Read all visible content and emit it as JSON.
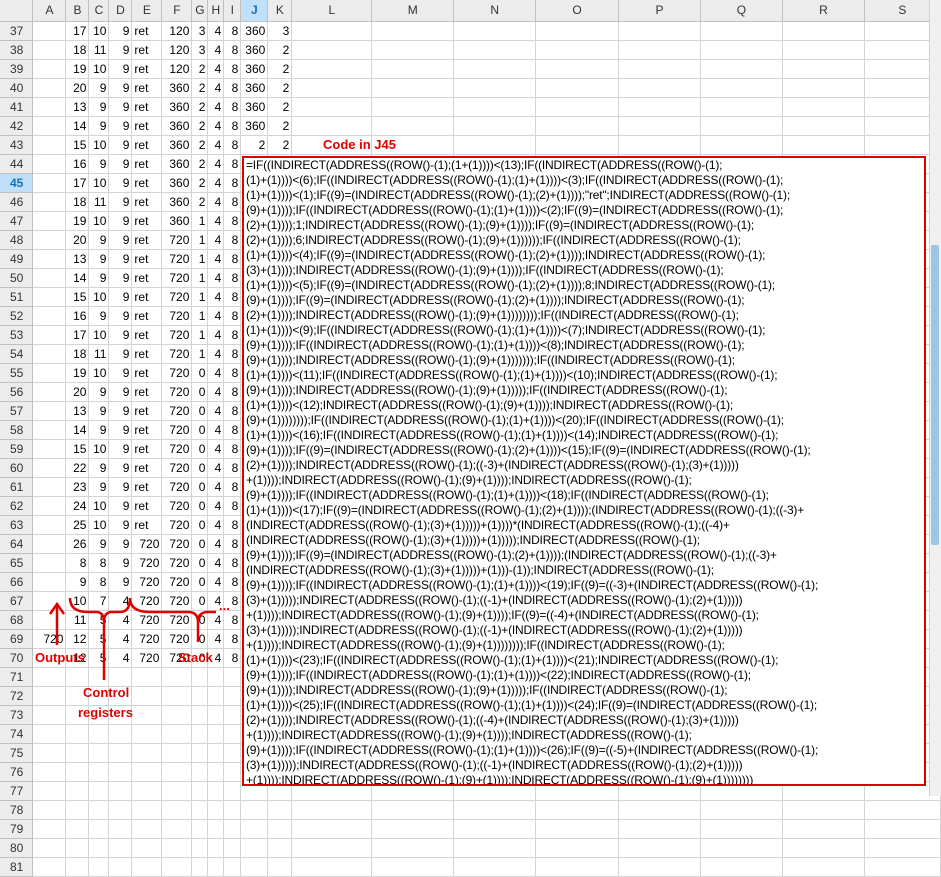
{
  "columns": [
    "A",
    "B",
    "C",
    "D",
    "E",
    "F",
    "G",
    "H",
    "I",
    "J",
    "K",
    "L",
    "M",
    "N",
    "O",
    "P",
    "Q",
    "R",
    "S"
  ],
  "selected_row": "45",
  "selected_column": "J",
  "rows": [
    {
      "n": "37",
      "cells": [
        "",
        "17",
        "10",
        "9",
        "ret",
        "120",
        "3",
        "4",
        "8",
        "360",
        "3"
      ]
    },
    {
      "n": "38",
      "cells": [
        "",
        "18",
        "11",
        "9",
        "ret",
        "120",
        "3",
        "4",
        "8",
        "360",
        "2"
      ]
    },
    {
      "n": "39",
      "cells": [
        "",
        "19",
        "10",
        "9",
        "ret",
        "120",
        "2",
        "4",
        "8",
        "360",
        "2"
      ]
    },
    {
      "n": "40",
      "cells": [
        "",
        "20",
        "9",
        "9",
        "ret",
        "360",
        "2",
        "4",
        "8",
        "360",
        "2"
      ]
    },
    {
      "n": "41",
      "cells": [
        "",
        "13",
        "9",
        "9",
        "ret",
        "360",
        "2",
        "4",
        "8",
        "360",
        "2"
      ]
    },
    {
      "n": "42",
      "cells": [
        "",
        "14",
        "9",
        "9",
        "ret",
        "360",
        "2",
        "4",
        "8",
        "360",
        "2"
      ]
    },
    {
      "n": "43",
      "cells": [
        "",
        "15",
        "10",
        "9",
        "ret",
        "360",
        "2",
        "4",
        "8",
        "2",
        "2"
      ]
    },
    {
      "n": "44",
      "cells": [
        "",
        "16",
        "9",
        "9",
        "ret",
        "360",
        "2",
        "4",
        "8",
        "2",
        "2"
      ]
    },
    {
      "n": "45",
      "cells": [
        "",
        "17",
        "10",
        "9",
        "ret",
        "360",
        "2",
        "4",
        "8",
        "",
        ""
      ]
    },
    {
      "n": "46",
      "cells": [
        "",
        "18",
        "11",
        "9",
        "ret",
        "360",
        "2",
        "4",
        "8",
        "",
        ""
      ]
    },
    {
      "n": "47",
      "cells": [
        "",
        "19",
        "10",
        "9",
        "ret",
        "360",
        "1",
        "4",
        "8",
        "",
        ""
      ]
    },
    {
      "n": "48",
      "cells": [
        "",
        "20",
        "9",
        "9",
        "ret",
        "720",
        "1",
        "4",
        "8",
        "",
        ""
      ]
    },
    {
      "n": "49",
      "cells": [
        "",
        "13",
        "9",
        "9",
        "ret",
        "720",
        "1",
        "4",
        "8",
        "",
        ""
      ]
    },
    {
      "n": "50",
      "cells": [
        "",
        "14",
        "9",
        "9",
        "ret",
        "720",
        "1",
        "4",
        "8",
        "",
        ""
      ]
    },
    {
      "n": "51",
      "cells": [
        "",
        "15",
        "10",
        "9",
        "ret",
        "720",
        "1",
        "4",
        "8",
        "",
        ""
      ]
    },
    {
      "n": "52",
      "cells": [
        "",
        "16",
        "9",
        "9",
        "ret",
        "720",
        "1",
        "4",
        "8",
        "",
        ""
      ]
    },
    {
      "n": "53",
      "cells": [
        "",
        "17",
        "10",
        "9",
        "ret",
        "720",
        "1",
        "4",
        "8",
        "",
        ""
      ]
    },
    {
      "n": "54",
      "cells": [
        "",
        "18",
        "11",
        "9",
        "ret",
        "720",
        "1",
        "4",
        "8",
        "",
        ""
      ]
    },
    {
      "n": "55",
      "cells": [
        "",
        "19",
        "10",
        "9",
        "ret",
        "720",
        "0",
        "4",
        "8",
        "",
        ""
      ]
    },
    {
      "n": "56",
      "cells": [
        "",
        "20",
        "9",
        "9",
        "ret",
        "720",
        "0",
        "4",
        "8",
        "",
        ""
      ]
    },
    {
      "n": "57",
      "cells": [
        "",
        "13",
        "9",
        "9",
        "ret",
        "720",
        "0",
        "4",
        "8",
        "",
        ""
      ]
    },
    {
      "n": "58",
      "cells": [
        "",
        "14",
        "9",
        "9",
        "ret",
        "720",
        "0",
        "4",
        "8",
        "",
        ""
      ]
    },
    {
      "n": "59",
      "cells": [
        "",
        "15",
        "10",
        "9",
        "ret",
        "720",
        "0",
        "4",
        "8",
        "",
        ""
      ]
    },
    {
      "n": "60",
      "cells": [
        "",
        "22",
        "9",
        "9",
        "ret",
        "720",
        "0",
        "4",
        "8",
        "",
        ""
      ]
    },
    {
      "n": "61",
      "cells": [
        "",
        "23",
        "9",
        "9",
        "ret",
        "720",
        "0",
        "4",
        "8",
        "",
        ""
      ]
    },
    {
      "n": "62",
      "cells": [
        "",
        "24",
        "10",
        "9",
        "ret",
        "720",
        "0",
        "4",
        "8",
        "",
        ""
      ]
    },
    {
      "n": "63",
      "cells": [
        "",
        "25",
        "10",
        "9",
        "ret",
        "720",
        "0",
        "4",
        "8",
        "",
        ""
      ]
    },
    {
      "n": "64",
      "cells": [
        "",
        "26",
        "9",
        "9",
        "720",
        "720",
        "0",
        "4",
        "8",
        "",
        ""
      ]
    },
    {
      "n": "65",
      "cells": [
        "",
        "8",
        "8",
        "9",
        "720",
        "720",
        "0",
        "4",
        "8",
        "",
        ""
      ]
    },
    {
      "n": "66",
      "cells": [
        "",
        "9",
        "8",
        "9",
        "720",
        "720",
        "0",
        "4",
        "8",
        "",
        ""
      ]
    },
    {
      "n": "67",
      "cells": [
        "",
        "10",
        "7",
        "4",
        "720",
        "720",
        "0",
        "4",
        "8",
        "",
        ""
      ]
    },
    {
      "n": "68",
      "cells": [
        "",
        "11",
        "5",
        "4",
        "720",
        "720",
        "0",
        "4",
        "8",
        "",
        ""
      ]
    },
    {
      "n": "69",
      "cells": [
        "720",
        "12",
        "5",
        "4",
        "720",
        "720",
        "0",
        "4",
        "8",
        "",
        ""
      ]
    },
    {
      "n": "70",
      "cells": [
        "",
        "12",
        "5",
        "4",
        "720",
        "720",
        "0",
        "4",
        "8",
        "",
        ""
      ]
    },
    {
      "n": "71",
      "cells": [
        "",
        "",
        "",
        "",
        "",
        "",
        "",
        "",
        "",
        "",
        ""
      ]
    },
    {
      "n": "72",
      "cells": [
        "",
        "",
        "",
        "",
        "",
        "",
        "",
        "",
        "",
        "",
        ""
      ]
    },
    {
      "n": "73",
      "cells": [
        "",
        "",
        "",
        "",
        "",
        "",
        "",
        "",
        "",
        "",
        ""
      ]
    },
    {
      "n": "74",
      "cells": [
        "",
        "",
        "",
        "",
        "",
        "",
        "",
        "",
        "",
        "",
        ""
      ]
    },
    {
      "n": "75",
      "cells": [
        "",
        "",
        "",
        "",
        "",
        "",
        "",
        "",
        "",
        "",
        ""
      ]
    },
    {
      "n": "76",
      "cells": [
        "",
        "",
        "",
        "",
        "",
        "",
        "",
        "",
        "",
        "",
        ""
      ]
    },
    {
      "n": "77",
      "cells": [
        "",
        "",
        "",
        "",
        "",
        "",
        "",
        "",
        "",
        "",
        ""
      ]
    },
    {
      "n": "78",
      "cells": [
        "",
        "",
        "",
        "",
        "",
        "",
        "",
        "",
        "",
        "",
        ""
      ]
    },
    {
      "n": "79",
      "cells": [
        "",
        "",
        "",
        "",
        "",
        "",
        "",
        "",
        "",
        "",
        ""
      ]
    },
    {
      "n": "80",
      "cells": [
        "",
        "",
        "",
        "",
        "",
        "",
        "",
        "",
        "",
        "",
        ""
      ]
    },
    {
      "n": "81",
      "cells": [
        "",
        "",
        "",
        "",
        "",
        "",
        "",
        "",
        "",
        "",
        ""
      ]
    }
  ],
  "code_title": "Code in J45",
  "code_lines": [
    "=IF((INDIRECT(ADDRESS((ROW()-(1);(1+(1))))<(13);IF((INDIRECT(ADDRESS((ROW()-(1);",
    "(1)+(1))))<(6);IF((INDIRECT(ADDRESS((ROW()-(1);(1)+(1))))<(3);IF((INDIRECT(ADDRESS((ROW()-(1);",
    "(1)+(1))))<(1);IF((9)=(INDIRECT(ADDRESS((ROW()-(1);(2)+(1))));\"ret\";INDIRECT(ADDRESS((ROW()-(1);",
    "(9)+(1))));IF((INDIRECT(ADDRESS((ROW()-(1);(1)+(1))))<(2);IF((9)=(INDIRECT(ADDRESS((ROW()-(1);",
    "(2)+(1))));1;INDIRECT(ADDRESS((ROW()-(1);(9)+(1))));IF((9)=(INDIRECT(ADDRESS((ROW()-(1);",
    "(2)+(1))));6;INDIRECT(ADDRESS((ROW()-(1);(9)+(1))))));IF((INDIRECT(ADDRESS((ROW()-(1);",
    "(1)+(1))))<(4);IF((9)=(INDIRECT(ADDRESS((ROW()-(1);(2)+(1))));INDIRECT(ADDRESS((ROW()-(1);",
    "(3)+(1))));INDIRECT(ADDRESS((ROW()-(1);(9)+(1))));IF((INDIRECT(ADDRESS((ROW()-(1);",
    "(1)+(1))))<(5);IF((9)=(INDIRECT(ADDRESS((ROW()-(1);(2)+(1))));8;INDIRECT(ADDRESS((ROW()-(1);",
    "(9)+(1))));IF((9)=(INDIRECT(ADDRESS((ROW()-(1);(2)+(1))));INDIRECT(ADDRESS((ROW()-(1);",
    "(2)+(1))));INDIRECT(ADDRESS((ROW()-(1);(9)+(1))))))));IF((INDIRECT(ADDRESS((ROW()-(1);",
    "(1)+(1))))<(9);IF((INDIRECT(ADDRESS((ROW()-(1);(1)+(1))))<(7);INDIRECT(ADDRESS((ROW()-(1);",
    "(9)+(1))));IF((INDIRECT(ADDRESS((ROW()-(1);(1)+(1))))<(8);INDIRECT(ADDRESS((ROW()-(1);",
    "(9)+(1))));INDIRECT(ADDRESS((ROW()-(1);(9)+(1)))))));IF((INDIRECT(ADDRESS((ROW()-(1);",
    "(1)+(1))))<(11);IF((INDIRECT(ADDRESS((ROW()-(1);(1)+(1))))<(10);INDIRECT(ADDRESS((ROW()-(1);",
    "(9)+(1))));INDIRECT(ADDRESS((ROW()-(1);(9)+(1)))));IF((INDIRECT(ADDRESS((ROW()-(1);",
    "(1)+(1))))<(12);INDIRECT(ADDRESS((ROW()-(1);(9)+(1))));INDIRECT(ADDRESS((ROW()-(1);",
    "(9)+(1))))))));IF((INDIRECT(ADDRESS((ROW()-(1);(1)+(1))))<(20);IF((INDIRECT(ADDRESS((ROW()-(1);",
    "(1)+(1))))<(16);IF((INDIRECT(ADDRESS((ROW()-(1);(1)+(1))))<(14);INDIRECT(ADDRESS((ROW()-(1);",
    "(9)+(1))));IF((9)=(INDIRECT(ADDRESS((ROW()-(1);(2)+(1))))<(15);IF((9)=(INDIRECT(ADDRESS((ROW()-(1);",
    "(2)+(1))));INDIRECT(ADDRESS((ROW()-(1);((-3)+(INDIRECT(ADDRESS((ROW()-(1);(3)+(1)))))",
    "+(1))));INDIRECT(ADDRESS((ROW()-(1);(9)+(1))));INDIRECT(ADDRESS((ROW()-(1);",
    "(9)+(1))));IF((INDIRECT(ADDRESS((ROW()-(1);(1)+(1))))<(18);IF((INDIRECT(ADDRESS((ROW()-(1);",
    "(1)+(1))))<(17);IF((9)=(INDIRECT(ADDRESS((ROW()-(1);(2)+(1))));(INDIRECT(ADDRESS((ROW()-(1);((-3)+",
    "(INDIRECT(ADDRESS((ROW()-(1);(3)+(1)))))+(1))))*(INDIRECT(ADDRESS((ROW()-(1);((-4)+",
    "(INDIRECT(ADDRESS((ROW()-(1);(3)+(1)))))+(1)))));INDIRECT(ADDRESS((ROW()-(1);",
    "(9)+(1))));IF((9)=(INDIRECT(ADDRESS((ROW()-(1);(2)+(1))));(INDIRECT(ADDRESS((ROW()-(1);((-3)+",
    "(INDIRECT(ADDRESS((ROW()-(1);(3)+(1)))))+(1)))-(1));INDIRECT(ADDRESS((ROW()-(1);",
    "(9)+(1))));IF((INDIRECT(ADDRESS((ROW()-(1);(1)+(1))))<(19);IF((9)=((-3)+(INDIRECT(ADDRESS((ROW()-(1);",
    "(3)+(1)))));INDIRECT(ADDRESS((ROW()-(1);((-1)+(INDIRECT(ADDRESS((ROW()-(1);(2)+(1)))))",
    "+(1))));INDIRECT(ADDRESS((ROW()-(1);(9)+(1))));IF((9)=((-4)+(INDIRECT(ADDRESS((ROW()-(1);",
    "(3)+(1)))));INDIRECT(ADDRESS((ROW()-(1);((-1)+(INDIRECT(ADDRESS((ROW()-(1);(2)+(1)))))",
    "+(1))));INDIRECT(ADDRESS((ROW()-(1);(9)+(1))))))));IF((INDIRECT(ADDRESS((ROW()-(1);",
    "(1)+(1))))<(23);IF((INDIRECT(ADDRESS((ROW()-(1);(1)+(1))))<(21);INDIRECT(ADDRESS((ROW()-(1);",
    "(9)+(1))));IF((INDIRECT(ADDRESS((ROW()-(1);(1)+(1))))<(22);INDIRECT(ADDRESS((ROW()-(1);",
    "(9)+(1))));INDIRECT(ADDRESS((ROW()-(1);(9)+(1)))));IF((INDIRECT(ADDRESS((ROW()-(1);",
    "(1)+(1))))<(25);IF((INDIRECT(ADDRESS((ROW()-(1);(1)+(1))))<(24);IF((9)=(INDIRECT(ADDRESS((ROW()-(1);",
    "(2)+(1))));INDIRECT(ADDRESS((ROW()-(1);((-4)+(INDIRECT(ADDRESS((ROW()-(1);(3)+(1)))))",
    "+(1))));INDIRECT(ADDRESS((ROW()-(1);(9)+(1))));INDIRECT(ADDRESS((ROW()-(1);",
    "(9)+(1))));IF((INDIRECT(ADDRESS((ROW()-(1);(1)+(1))))<(26);IF((9)=((-5)+(INDIRECT(ADDRESS((ROW()-(1);",
    "(3)+(1)))));INDIRECT(ADDRESS((ROW()-(1);((-1)+(INDIRECT(ADDRESS((ROW()-(1);(2)+(1)))))",
    "+(1))));INDIRECT(ADDRESS((ROW()-(1);(9)+(1))));INDIRECT(ADDRESS((ROW()-(1);(9)+(1))))))))"
  ],
  "annotations": {
    "outputs": "Outputs",
    "control_registers_1": "Control",
    "control_registers_2": "registers",
    "stack": "Stack",
    "ellipsis": "..."
  },
  "colors": {
    "annotation_red": "#e00000",
    "selection_blue": "#bfe0f8"
  }
}
